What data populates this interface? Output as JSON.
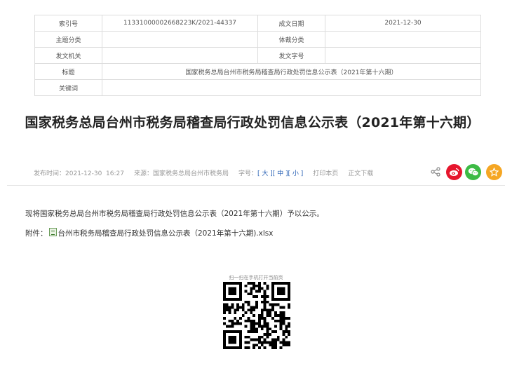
{
  "meta_table": {
    "index_label": "索引号",
    "index_value": "11331000002668223K/2021-44337",
    "date_label": "成文日期",
    "date_value": "2021-12-30",
    "topic_label": "主题分类",
    "topic_value": "",
    "genre_label": "体裁分类",
    "genre_value": "",
    "issuer_label": "发文机关",
    "issuer_value": "",
    "docno_label": "发文字号",
    "docno_value": "",
    "title_label": "标题",
    "title_value": "国家税务总局台州市税务局稽查局行政处罚信息公示表（2021年第十六期）",
    "keywords_label": "关键词",
    "keywords_value": ""
  },
  "article": {
    "title": "国家税务总局台州市税务局稽查局行政处罚信息公示表（2021年第十六期）",
    "publish_time_label": "发布时间：",
    "publish_time": "2021-12-30  16:27",
    "source_label": "来源：",
    "source": "国家税务总局台州市税务局",
    "font_size_label": "字号：",
    "font_large": "[ 大 ]",
    "font_medium": "[ 中 ]",
    "font_small": "[ 小 ]",
    "print_label": "打印本页",
    "download_label": "正文下载",
    "paragraph": "现将国家税务总局台州市税务局稽查局行政处罚信息公示表（2021年第十六期）予以公示。",
    "attachment_label": "附件：",
    "attachment_name": "台州市税务局稽查局行政处罚信息公示表（2021年第十六期).xlsx",
    "qr_caption": "扫一扫在手机打开当前页"
  },
  "share": {
    "icons": [
      "share-icon",
      "weibo-icon",
      "wechat-icon",
      "favorite-icon"
    ],
    "colors": {
      "weibo": "#e6162d",
      "wechat": "#3dbb45",
      "favorite": "#f5a623"
    }
  }
}
